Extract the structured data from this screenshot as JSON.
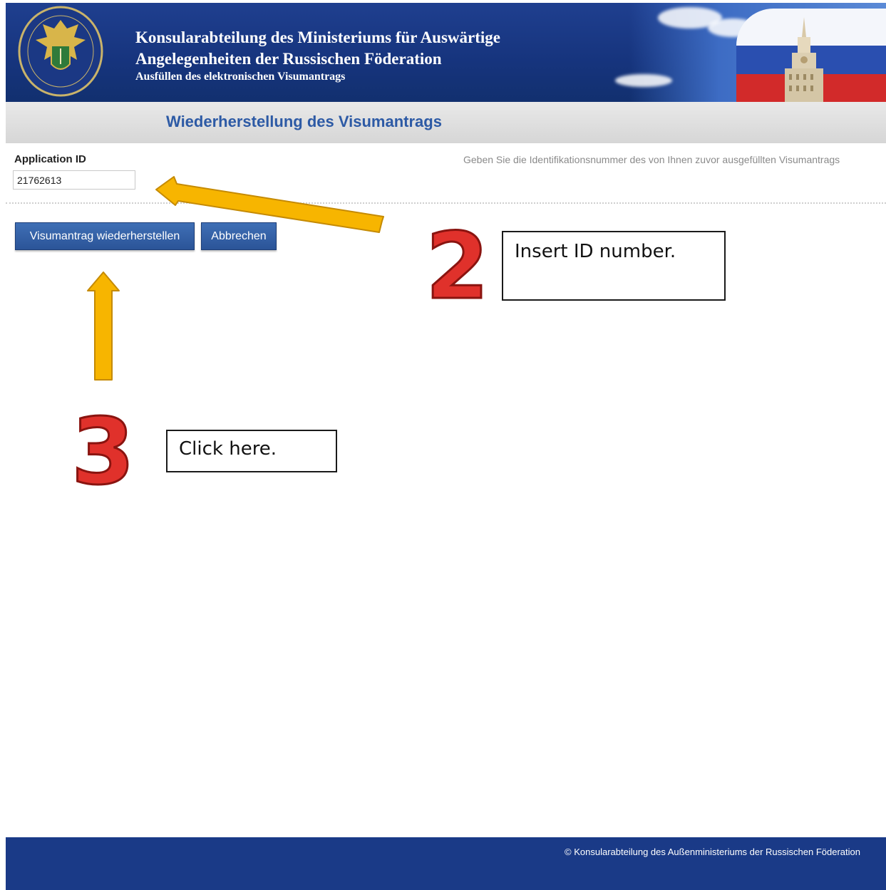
{
  "header": {
    "title_line1": "Konsularabteilung des Ministeriums für Auswärtige",
    "title_line2": "Angelegenheiten der Russischen Föderation",
    "subtitle": "Ausfüllen des elektronischen Visumantrags"
  },
  "page": {
    "title": "Wiederherstellung des Visumantrags"
  },
  "form": {
    "label": "Application ID",
    "value": "21762613",
    "hint": "Geben Sie die Identifikationsnummer des von Ihnen zuvor ausgefüllten Visumantrags"
  },
  "buttons": {
    "restore": "Visumantrag wiederherstellen",
    "cancel": "Abbrechen"
  },
  "annotations": {
    "step2_number": "2",
    "step2_text": "Insert ID number.",
    "step3_number": "3",
    "step3_text": "Click here."
  },
  "footer": {
    "text": "© Konsularabteilung des Außenministeriums der Russischen Föderation"
  },
  "colors": {
    "header_blue": "#1f3f8f",
    "title_blue": "#2d5aa5",
    "button_blue": "#2b5498",
    "arrow_yellow": "#f7b500",
    "number_red": "#e0312b"
  },
  "icons": [
    "coat-of-arms-emblem",
    "russian-flag-image",
    "ministry-tower-image"
  ]
}
